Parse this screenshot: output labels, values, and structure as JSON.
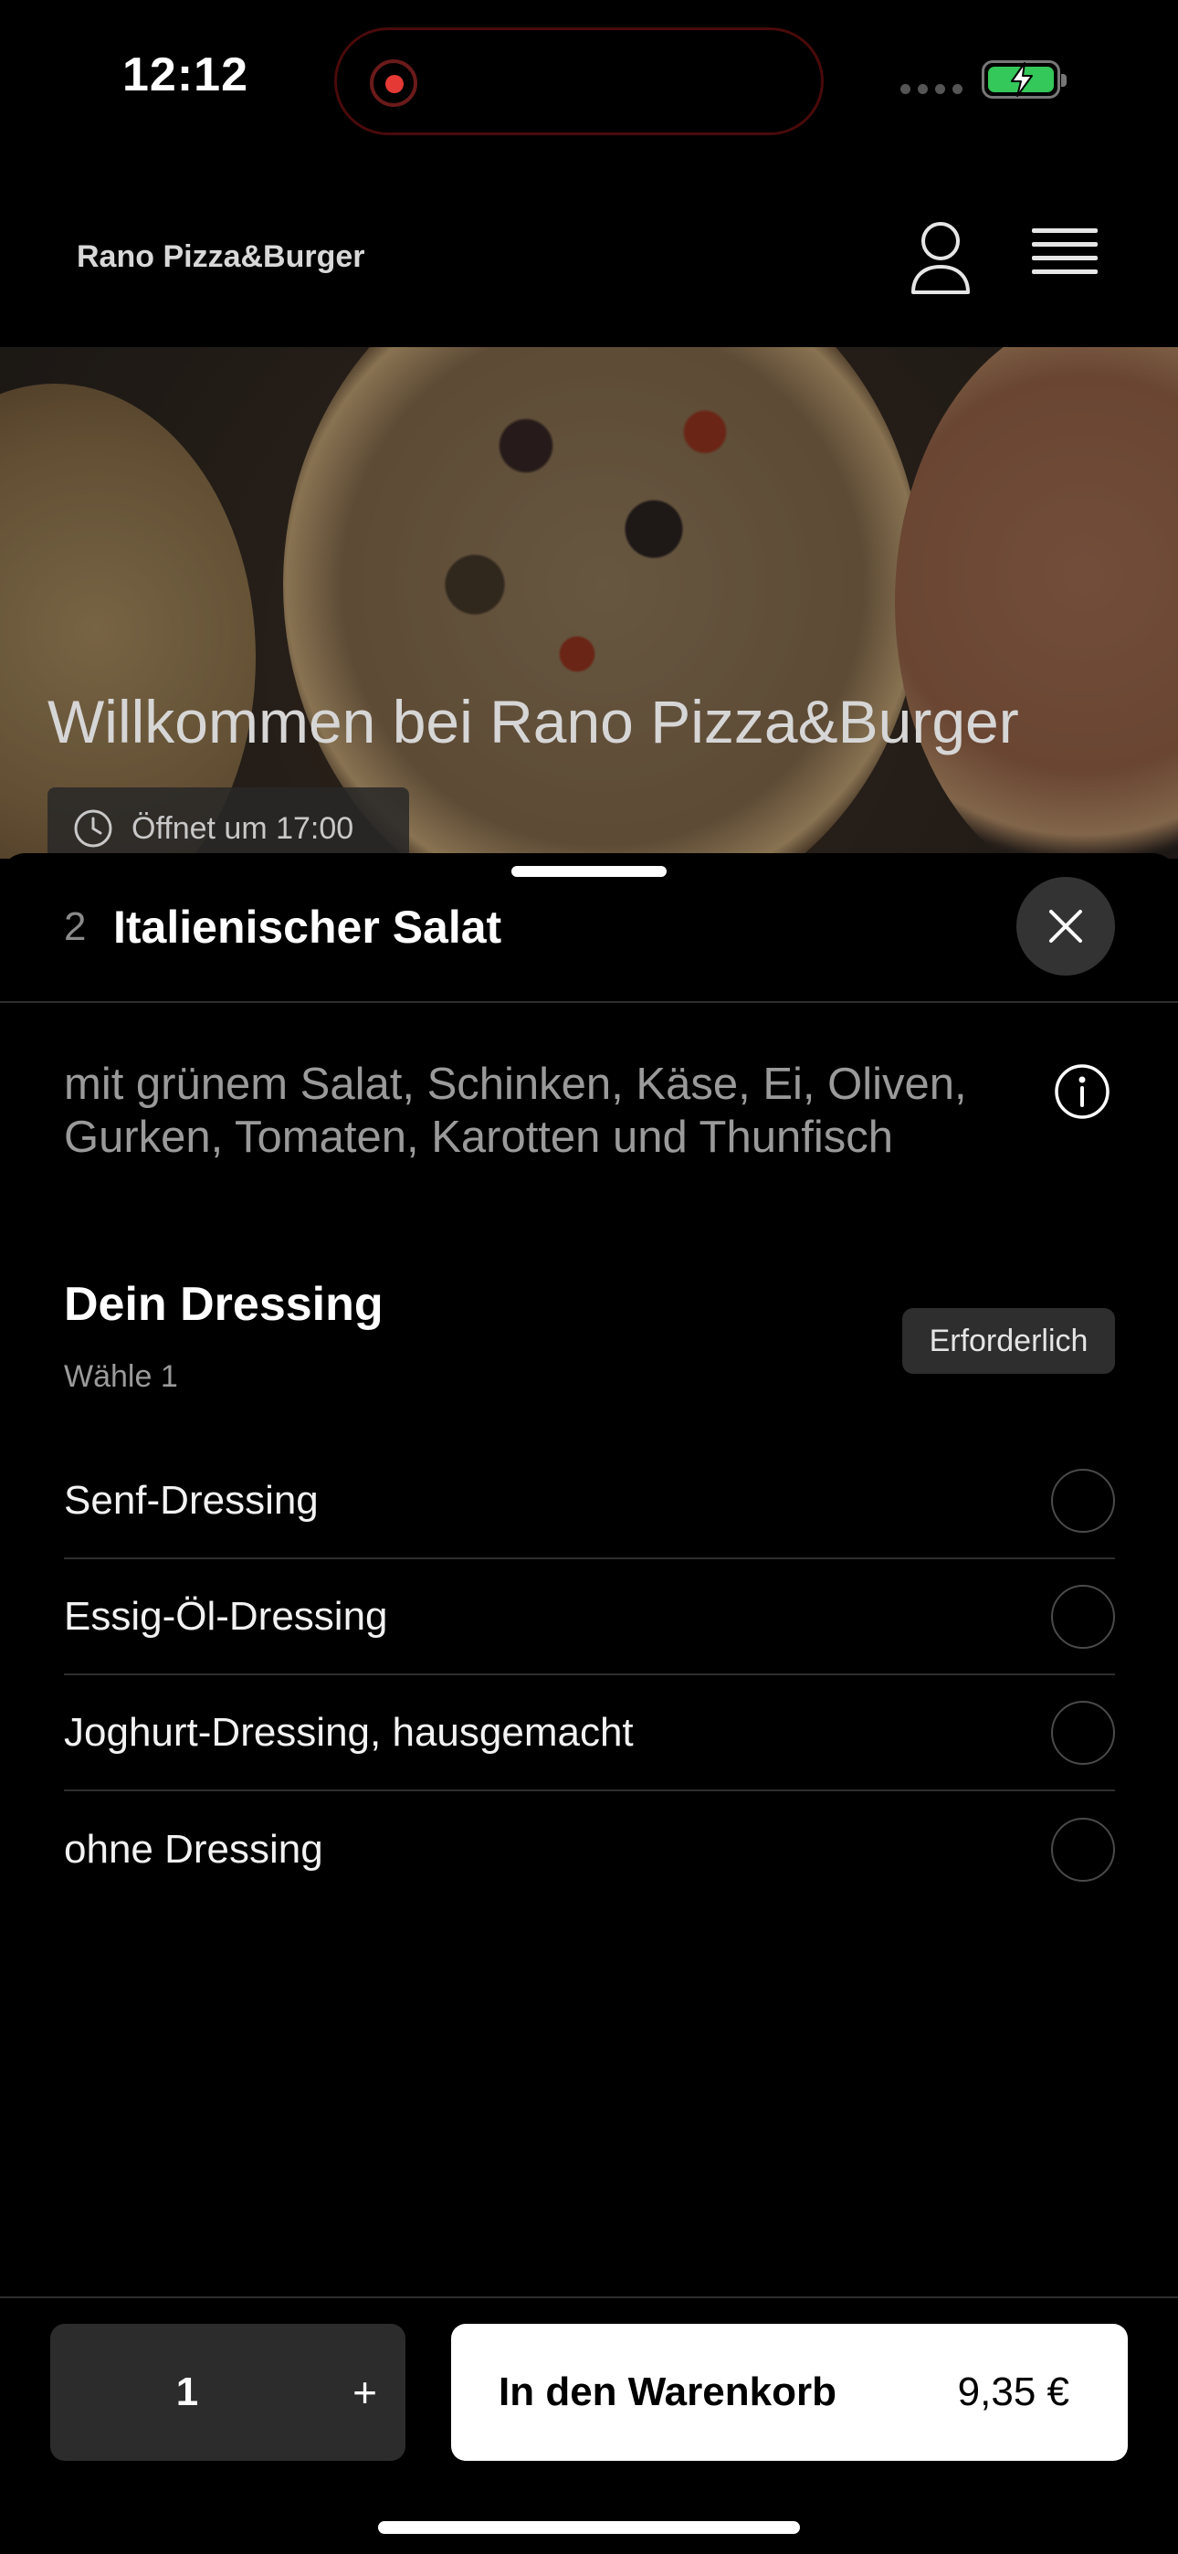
{
  "status_bar": {
    "time": "12:12",
    "recording_indicator_color": "#e53935",
    "battery_color": "#34c759",
    "battery_level": 1.0
  },
  "header": {
    "title": "Rano Pizza&Burger",
    "user_icon": "user-icon",
    "menu_icon": "hamburger-menu-icon"
  },
  "hero": {
    "title": "Willkommen bei Rano Pizza&Burger",
    "opening_text": "Öffnet um 17:00",
    "opening_icon": "clock-icon"
  },
  "sheet": {
    "item_number": "2",
    "item_title": "Italienischer Salat",
    "description": "mit grünem Salat, Schinken, Käse, Ei, Oliven, Gurken, Tomaten, Karotten und Thunfisch",
    "close_icon": "close-icon",
    "info_icon": "info-icon",
    "option_group": {
      "title": "Dein Dressing",
      "subtitle": "Wähle 1",
      "badge": "Erforderlich",
      "options": [
        {
          "label": "Senf-Dressing",
          "selected": false
        },
        {
          "label": "Essig-Öl-Dressing",
          "selected": false
        },
        {
          "label": "Joghurt-Dressing, hausgemacht",
          "selected": false
        },
        {
          "label": "ohne Dressing",
          "selected": false
        }
      ]
    }
  },
  "footer": {
    "quantity": "1",
    "plus_label": "+",
    "cart_label": "In den Warenkorb",
    "price": "9,35 €"
  }
}
